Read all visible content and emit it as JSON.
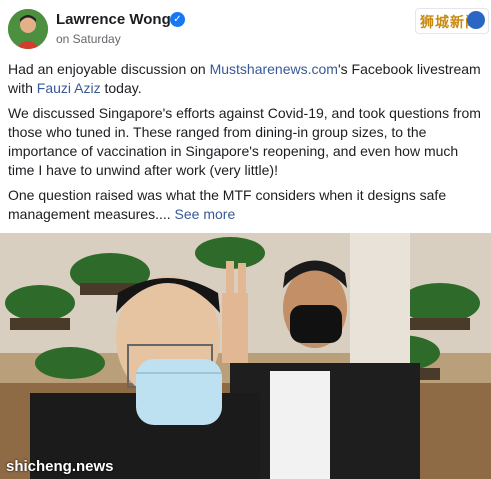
{
  "header": {
    "author": "Lawrence Wong",
    "time": "on Saturday",
    "brand": "狮城新闻"
  },
  "post": {
    "p1_a": "Had an enjoyable discussion on ",
    "p1_link": "Mustsharenews.com",
    "p1_b": "'s Facebook livestream with ",
    "p1_link2": "Fauzi Aziz",
    "p1_c": " today.",
    "p2": "We discussed Singapore's efforts against Covid-19, and took questions from those who tuned in. These ranged from dining-in group sizes, to the importance of vaccination in Singapore's reopening, and even how much time I have to unwind after work (very little)!",
    "p3": "One question raised was what the MTF considers when it designs safe management measures.... ",
    "see_more": "See more"
  },
  "photo": {
    "watermark": "shicheng.news"
  },
  "colors": {
    "link": "#385898",
    "verified": "#1877f2"
  }
}
